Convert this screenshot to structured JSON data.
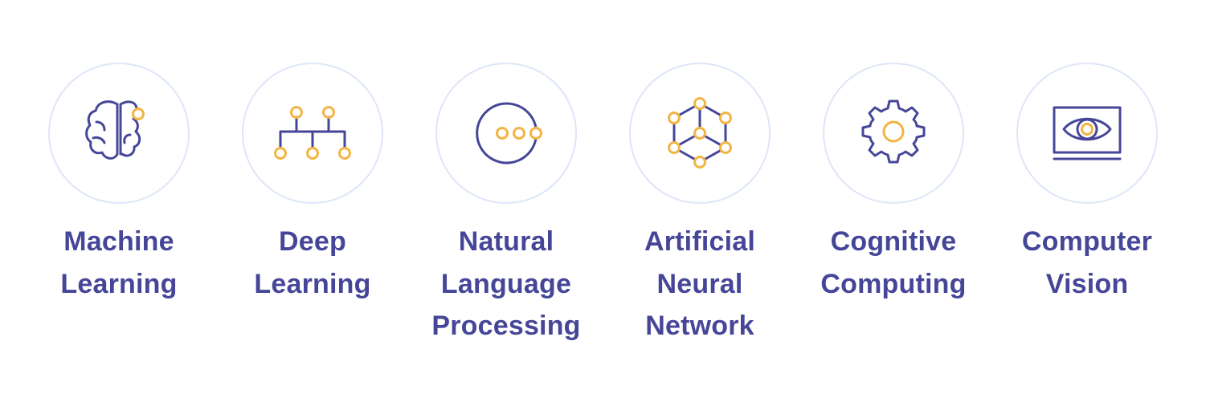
{
  "colors": {
    "text": "#464699",
    "icon_primary": "#464699",
    "icon_accent": "#f2b544",
    "circle_border": "#dde6f8",
    "background": "#ffffff"
  },
  "topics": [
    {
      "icon": "brain-icon",
      "label_lines": [
        "Machine",
        "Learning"
      ]
    },
    {
      "icon": "hierarchy-network-icon",
      "label_lines": [
        "Deep",
        "Learning"
      ]
    },
    {
      "icon": "speech-bubble-icon",
      "label_lines": [
        "Natural",
        "Language",
        "Processing"
      ]
    },
    {
      "icon": "hexagon-network-icon",
      "label_lines": [
        "Artificial",
        "Neural",
        "Network"
      ]
    },
    {
      "icon": "gear-icon",
      "label_lines": [
        "Cognitive",
        "Computing"
      ]
    },
    {
      "icon": "eye-monitor-icon",
      "label_lines": [
        "Computer",
        "Vision"
      ]
    }
  ]
}
